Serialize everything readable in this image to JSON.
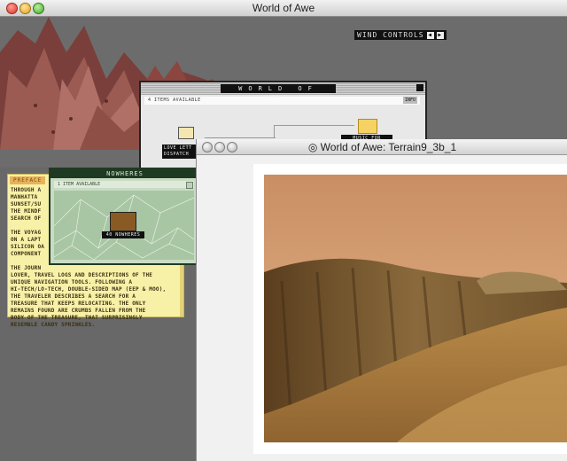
{
  "main_window": {
    "title": "World of Awe"
  },
  "wind_controls": {
    "label": "WIND CONTROLS"
  },
  "preface": {
    "tab": "PREFACE",
    "text": "THROUGH A\nMANHATTA\nSUNSET/SU\nTHE MINDF\nSEARCH OF\n\nTHE VOYAG\nON A LAPT\nSILICON OA\nCOMPONENT\n\nTHE JOURN\nLOVER, TRAVEL LOGS AND DESCRIPTIONS OF THE\nUNIQUE NAVIGATION TOOLS. FOLLOWING A\nHI-TECH/LO-TECH, DOUBLE-SIDED MAP (EEP & MOO),\nTHE TRAVELER DESCRIBES A SEARCH FOR A\nTREASURE THAT KEEPS RELOCATING. THE ONLY\nREMAINS FOUND ARE CRUMBS FALLEN FROM THE\nBODY OF THE TREASURE, THAT SURPRISINGLY\nRESEMBLE CANDY SPRINKLES."
  },
  "woa_dialog": {
    "title": "WORLD OF AWE",
    "count": "4 ITEMS AVAILABLE",
    "info": "INFO",
    "item_love": "LOVE LETT\nDISPATCH",
    "item_music": "MUSIC FOR"
  },
  "nowheres_dialog": {
    "title": "NOWHERES",
    "count": "1 ITEM AVAILABLE",
    "item": "40 NOWHERES"
  },
  "terrain_window": {
    "title": "◎ World of Awe: Terrain9_3b_1"
  }
}
